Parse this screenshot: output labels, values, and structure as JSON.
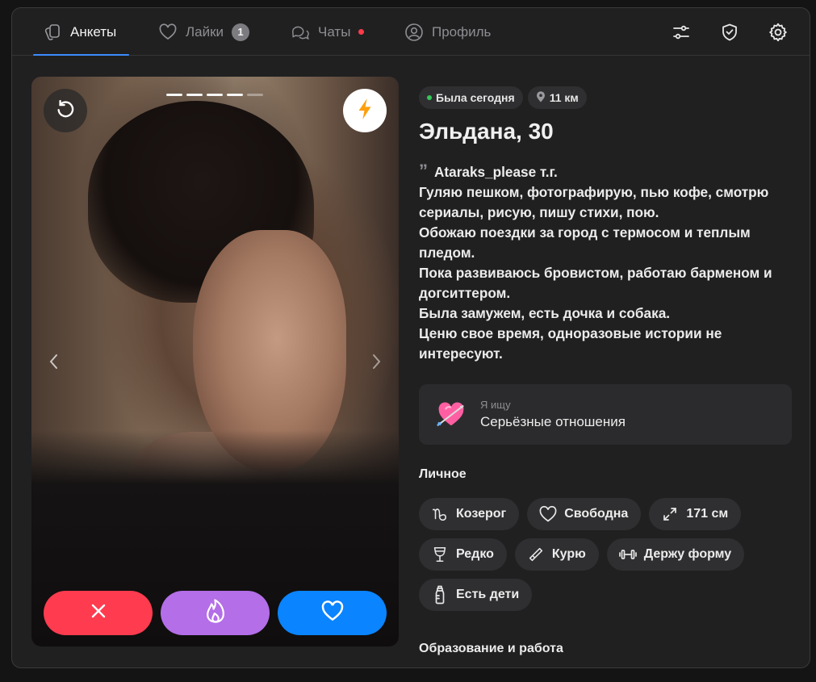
{
  "nav": {
    "tabs": [
      {
        "label": "Анкеты",
        "icon": "cards-icon",
        "active": true
      },
      {
        "label": "Лайки",
        "icon": "heart-icon",
        "badge": "1"
      },
      {
        "label": "Чаты",
        "icon": "chats-icon",
        "unread_dot": true
      },
      {
        "label": "Профиль",
        "icon": "profile-icon"
      }
    ],
    "actions": [
      "filters-icon",
      "shield-check-icon",
      "settings-gear-icon"
    ]
  },
  "photo": {
    "total": 5,
    "current": 4,
    "buttons": [
      "undo-icon",
      "boost-lightning-icon"
    ],
    "actions": [
      {
        "name": "dislike-button",
        "icon": "close-icon",
        "color": "#ff3b4f"
      },
      {
        "name": "superlike-button",
        "icon": "flame-icon",
        "color": "#b46ee8"
      },
      {
        "name": "like-button",
        "icon": "heart-icon",
        "color": "#0a84ff"
      }
    ]
  },
  "profile": {
    "status": "Была сегодня",
    "distance": "11 км",
    "name": "Эльдана, 30",
    "bio_lines": [
      "Ataraks_please т.г.",
      "Гуляю пешком, фотографирую, пью кофе, смотрю сериалы, рисую, пишу стихи, пою.",
      "Обожаю поездки за город с термосом и теплым пледом.",
      "Пока развиваюсь бровистом, работаю барменом и догситтером.",
      "Была замужем, есть дочка и собака.",
      "Ценю свое время, одноразовые истории не интересуют."
    ],
    "looking_for": {
      "label": "Я ищу",
      "value": "Серьёзные отношения"
    },
    "personal_title": "Личное",
    "tags": [
      {
        "label": "Козерог",
        "icon": "capricorn-icon"
      },
      {
        "label": "Свободна",
        "icon": "heart-outline-icon"
      },
      {
        "label": "171 см",
        "icon": "height-arrows-icon"
      },
      {
        "label": "Редко",
        "icon": "wine-glass-icon"
      },
      {
        "label": "Курю",
        "icon": "cigarette-icon"
      },
      {
        "label": "Держу форму",
        "icon": "dumbbell-icon"
      },
      {
        "label": "Есть дети",
        "icon": "baby-bottle-icon"
      }
    ],
    "education_title": "Образование и работа"
  },
  "colors": {
    "accent": "#3d8bff",
    "online": "#34c759",
    "badge_red": "#ff3b4a"
  }
}
